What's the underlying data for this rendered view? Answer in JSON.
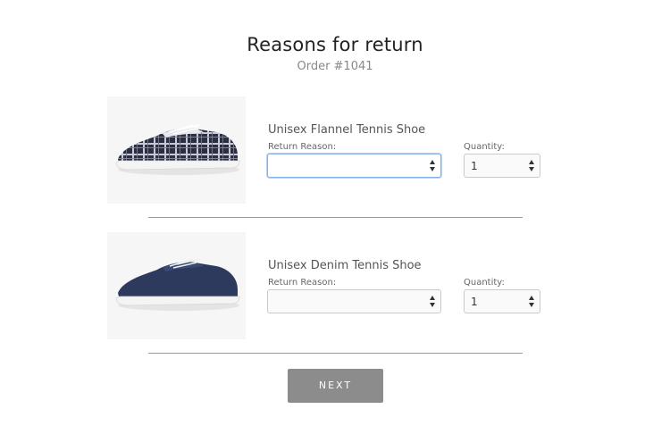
{
  "page": {
    "title": "Reasons for return",
    "order": "Order #1041"
  },
  "items": [
    {
      "name": "Unisex Flannel Tennis Shoe",
      "reason_label": "Return Reason:",
      "reason_value": "",
      "quantity_label": "Quantity:",
      "quantity_value": "1",
      "image": "plaid-tennis-shoe"
    },
    {
      "name": "Unisex Denim Tennis Shoe",
      "reason_label": "Return Reason:",
      "reason_value": "",
      "quantity_label": "Quantity:",
      "quantity_value": "1",
      "image": "denim-tennis-shoe"
    }
  ],
  "actions": {
    "next_label": "NEXT"
  },
  "colors": {
    "button": "#8c8c8c",
    "focus": "#8ab0e6",
    "divider": "#9a9a9a"
  }
}
